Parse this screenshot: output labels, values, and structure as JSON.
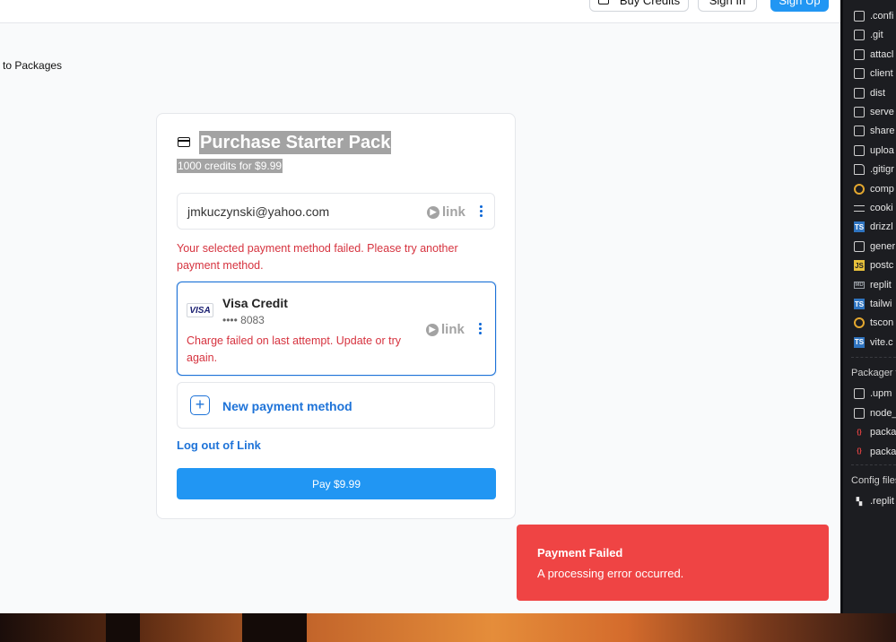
{
  "topbar": {
    "buy_credits_label": "Buy Credits",
    "sign_in_label": "Sign In",
    "sign_up_label": "Sign Up"
  },
  "back_link": "to Packages",
  "purchase": {
    "title": "Purchase Starter Pack",
    "subtitle": "1000 credits for $9.99",
    "email": "jmkuczynski@yahoo.com",
    "link_label": "link",
    "error_message": "Your selected payment method failed. Please try another payment method.",
    "card": {
      "brand": "VISA",
      "name": "Visa Credit",
      "number": "•••• 8083",
      "error": "Charge failed on last attempt. Update or try again."
    },
    "new_payment_label": "New payment method",
    "logout_label": "Log out of Link",
    "pay_label": "Pay $9.99"
  },
  "toast": {
    "title": "Payment Failed",
    "description": "A processing error occurred."
  },
  "sidebar": {
    "files": [
      {
        "name": ".confi",
        "icon": "folder-icon"
      },
      {
        "name": ".git",
        "icon": "folder-icon"
      },
      {
        "name": "attacl",
        "icon": "folder-icon"
      },
      {
        "name": "client",
        "icon": "folder-icon"
      },
      {
        "name": "dist",
        "icon": "folder-icon"
      },
      {
        "name": "serve",
        "icon": "folder-icon"
      },
      {
        "name": "share",
        "icon": "folder-icon"
      },
      {
        "name": "uploa",
        "icon": "folder-icon"
      },
      {
        "name": ".gitigr",
        "icon": "file-icon"
      },
      {
        "name": "comp",
        "icon": "config-ring-icon"
      },
      {
        "name": "cooki",
        "icon": "text-lines-icon"
      },
      {
        "name": "drizzl",
        "icon": "typescript-icon"
      },
      {
        "name": "gener",
        "icon": "image-icon"
      },
      {
        "name": "postc",
        "icon": "javascript-icon"
      },
      {
        "name": "replit",
        "icon": "markdown-icon"
      },
      {
        "name": "tailwi",
        "icon": "typescript-icon"
      },
      {
        "name": "tscon",
        "icon": "config-ring-icon"
      },
      {
        "name": "vite.c",
        "icon": "typescript-icon"
      }
    ],
    "packager_header": "Packager f",
    "packager_files": [
      {
        "name": ".upm",
        "icon": "folder-icon"
      },
      {
        "name": "node_",
        "icon": "folder-icon"
      },
      {
        "name": "packa",
        "icon": "json-icon"
      },
      {
        "name": "packa",
        "icon": "json-icon"
      }
    ],
    "config_header": "Config files",
    "config_files": [
      {
        "name": ".replit",
        "icon": "replit-icon"
      }
    ]
  },
  "colors": {
    "primary": "#2196f3",
    "link_blue": "#1e73d8",
    "error_red": "#d6333f",
    "toast_red": "#ef4444"
  }
}
